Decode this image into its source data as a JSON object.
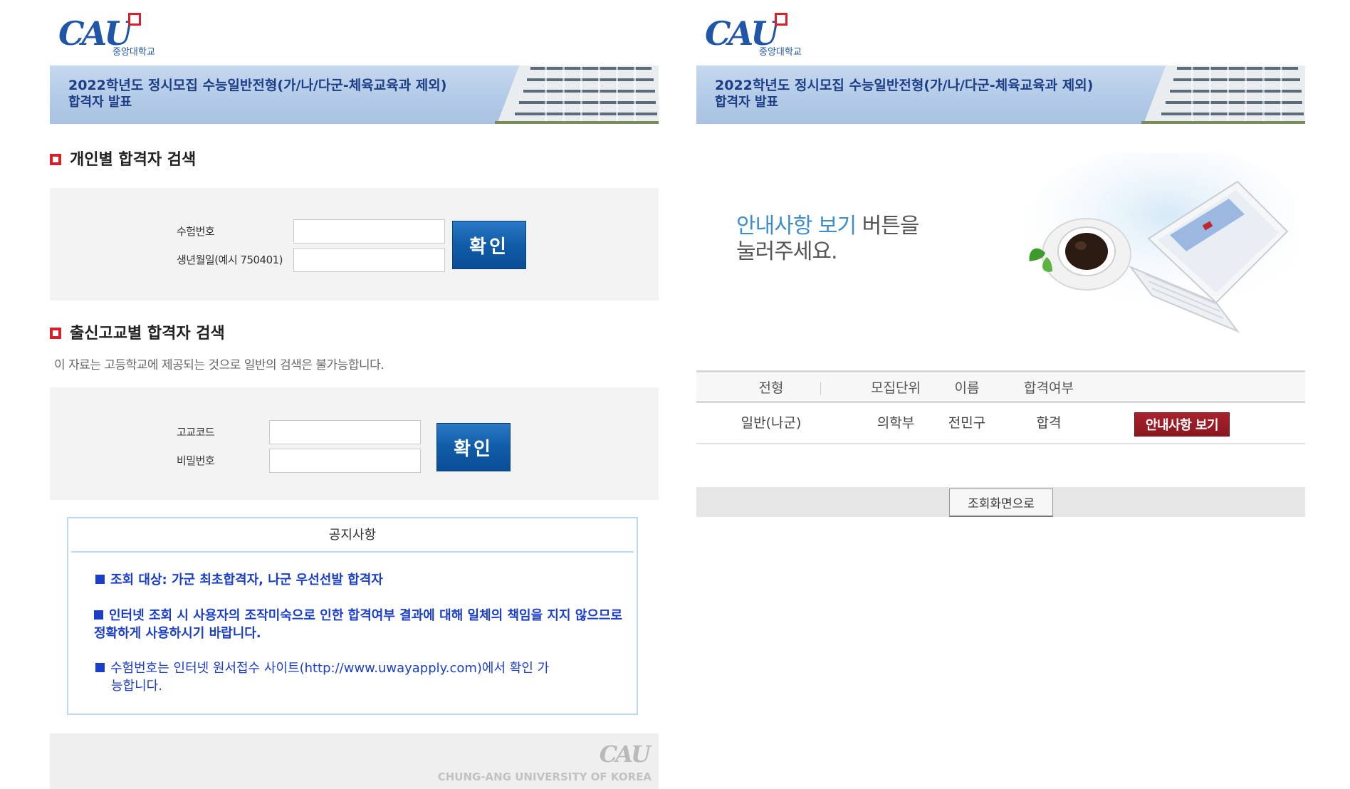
{
  "left": {
    "logo": {
      "mark": "CAU",
      "sub": "중앙대학교"
    },
    "banner": {
      "title": "2022학년도 정시모집 수능일반전형(가/나/다군-체육교육과 제외)",
      "subtitle": "합격자 발표"
    },
    "individual_search": {
      "title": "개인별 합격자 검색",
      "exam_number_label": "수험번호",
      "birthdate_label": "생년월일(예시 750401)",
      "exam_number_value": "",
      "birthdate_value": "",
      "confirm_label": "확인"
    },
    "school_search": {
      "title": "출신고교별 합격자 검색",
      "description": "이 자료는 고등학교에 제공되는 것으로 일반의 검색은 불가능합니다.",
      "school_code_label": "고교코드",
      "password_label": "비밀번호",
      "school_code_value": "",
      "password_value": "",
      "confirm_label": "확인"
    },
    "notice": {
      "title": "공지사항",
      "items": [
        "조회 대상: 가군 최초합격자, 나군 우선선발 합격자",
        "인터넷 조회 시 사용자의 조작미숙으로 인한 합격여부 결과에 대해 일체의 책임을 지지 않으므로 정확하게 사용하시기 바랍니다.",
        "수험번호는 인터넷 원서접수 사이트(http://www.uwayapply.com)에서 확인 가능합니다."
      ]
    },
    "footer": {
      "logo": "CAU",
      "text": "CHUNG-ANG UNIVERSITY OF KOREA"
    }
  },
  "right": {
    "logo": {
      "mark": "CAU",
      "sub": "중앙대학교"
    },
    "banner": {
      "title": "2022학년도 정시모집 수능일반전형(가/나/다군-체육교육과 제외)",
      "subtitle": "합격자 발표"
    },
    "guide": {
      "highlight": "안내사항 보기",
      "rest_line1": " 버튼을",
      "line2": "눌러주세요."
    },
    "table": {
      "headers": [
        "전형",
        "모집단위",
        "이름",
        "합격여부"
      ],
      "row": [
        "일반(나군)",
        "의학부",
        "전민구",
        "합격"
      ],
      "action_label": "안내사항 보기"
    },
    "back_button_label": "조회화면으로"
  },
  "colors": {
    "brand_blue": "#1f56a8",
    "accent_red": "#d8202a",
    "button_blue": "#115ca8",
    "guide_button_red": "#8a1820",
    "notice_text": "#1a3ec7",
    "guide_highlight": "#3d8dc9"
  }
}
